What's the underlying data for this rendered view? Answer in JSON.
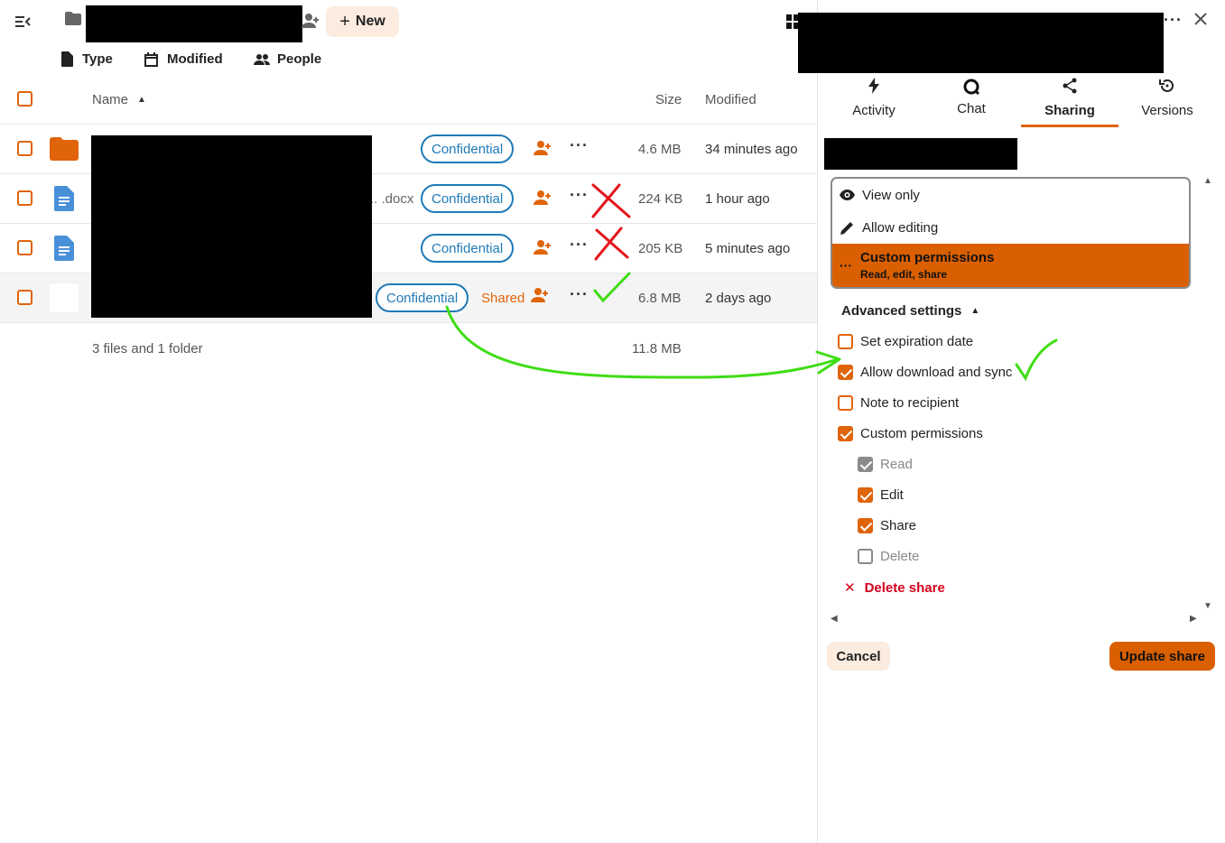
{
  "header": {
    "new_label": "New",
    "filters": [
      {
        "label": "Type",
        "icon": "document-icon"
      },
      {
        "label": "Modified",
        "icon": "calendar-icon"
      },
      {
        "label": "People",
        "icon": "people-icon"
      }
    ]
  },
  "table": {
    "columns": {
      "name": "Name",
      "size": "Size",
      "modified": "Modified"
    },
    "rows": [
      {
        "type": "folder",
        "ext": "",
        "tag": "Confidential",
        "size": "4.6 MB",
        "modified": "34 minutes ago",
        "shared": ""
      },
      {
        "type": "doc",
        "ext": "docx",
        "tag": "Confidential",
        "size": "224 KB",
        "modified": "1 hour ago",
        "shared": ""
      },
      {
        "type": "doc",
        "ext": "",
        "tag": "Confidential",
        "size": "205 KB",
        "modified": "5 minutes ago",
        "shared": ""
      },
      {
        "type": "file",
        "ext": "",
        "tag": "Confidential",
        "size": "6.8 MB",
        "modified": "2 days ago",
        "shared": "Shared"
      }
    ],
    "summary": {
      "label": "3 files and 1 folder",
      "size": "11.8 MB"
    }
  },
  "sidebar": {
    "tabs": [
      {
        "label": "Activity",
        "icon": "lightning-icon",
        "active": false
      },
      {
        "label": "Chat",
        "icon": "chat-icon",
        "active": false
      },
      {
        "label": "Sharing",
        "icon": "share-icon",
        "active": true
      },
      {
        "label": "Versions",
        "icon": "history-icon",
        "active": false
      }
    ],
    "permission_options": [
      {
        "label": "View only",
        "sub": "",
        "icon": "eye-icon",
        "selected": false
      },
      {
        "label": "Allow editing",
        "sub": "",
        "icon": "pencil-icon",
        "selected": false
      },
      {
        "label": "Custom permissions",
        "sub": "Read, edit, share",
        "icon": "more-icon",
        "selected": true
      }
    ],
    "advanced_label": "Advanced settings",
    "advanced": [
      {
        "label": "Set expiration date",
        "checked": false
      },
      {
        "label": "Allow download and sync",
        "checked": true
      },
      {
        "label": "Note to recipient",
        "checked": false
      },
      {
        "label": "Custom permissions",
        "checked": true
      }
    ],
    "custom": [
      {
        "label": "Read",
        "checked": true,
        "disabled": true
      },
      {
        "label": "Edit",
        "checked": true,
        "disabled": false
      },
      {
        "label": "Share",
        "checked": true,
        "disabled": false
      },
      {
        "label": "Delete",
        "checked": false,
        "disabled": true
      }
    ],
    "delete_share": "Delete share",
    "cancel": "Cancel",
    "update": "Update share"
  },
  "colors": {
    "accent": "#e0640a",
    "tag": "#1f7ab8",
    "danger": "#d4001c",
    "annot_green": "#3fdd14",
    "annot_red": "#e3161b"
  }
}
